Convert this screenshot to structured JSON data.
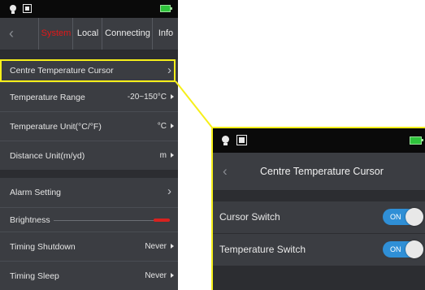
{
  "left_screen": {
    "tabs": [
      "System",
      "Local",
      "Connecting",
      "Info"
    ],
    "active_tab": "System",
    "rows": {
      "centre_cursor": {
        "label": "Centre Temperature Cursor"
      },
      "temp_range": {
        "label": "Temperature Range",
        "value": "-20~150°C"
      },
      "temp_unit": {
        "label": "Temperature Unit(°C/°F)",
        "value": "°C"
      },
      "distance_unit": {
        "label": "Distance Unit(m/yd)",
        "value": "m"
      },
      "alarm": {
        "label": "Alarm Setting"
      },
      "brightness": {
        "label": "Brightness",
        "level": 0.9
      },
      "timing_shutdown": {
        "label": "Timing Shutdown",
        "value": "Never"
      },
      "timing_sleep": {
        "label": "Timing Sleep",
        "value": "Never"
      }
    }
  },
  "right_screen": {
    "title": "Centre Temperature Cursor",
    "rows": {
      "cursor_switch": {
        "label": "Cursor Switch",
        "state": "ON"
      },
      "temperature_switch": {
        "label": "Temperature Switch",
        "state": "ON"
      }
    }
  },
  "icons": [
    "bulb-icon",
    "grid-icon",
    "battery-icon",
    "back-chevron-icon",
    "chevron-right-icon",
    "triangle-right-icon"
  ],
  "colors": {
    "highlight": "#f6ef1a",
    "active_tab": "#e21818",
    "toggle_on": "#2f8fd6",
    "battery": "#2fc43c",
    "brightness": "#d8221f"
  }
}
